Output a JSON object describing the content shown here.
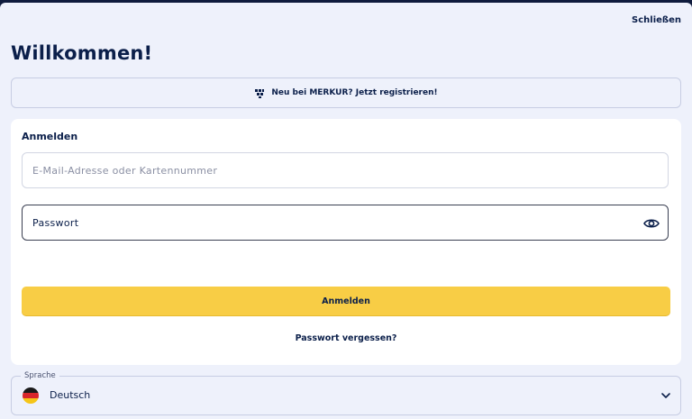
{
  "header": {
    "close_label": "Schließen",
    "title": "Willkommen!"
  },
  "register": {
    "label": "Neu bei MERKUR? Jetzt registrieren!",
    "icon": "merkur-logo-icon"
  },
  "login": {
    "section_title": "Anmelden",
    "email_placeholder": "E-Mail-Adresse oder Kartennummer",
    "password_label": "Passwort",
    "password_toggle_icon": "eye-icon",
    "submit_label": "Anmelden",
    "forgot_label": "Passwort vergessen?"
  },
  "language": {
    "label": "Sprache",
    "value": "Deutsch",
    "flag_icon": "germany-flag-icon",
    "dropdown_icon": "chevron-down-icon"
  },
  "colors": {
    "accent": "#f8cd45",
    "navy": "#0b1f4a",
    "panel": "#eef1fb"
  }
}
